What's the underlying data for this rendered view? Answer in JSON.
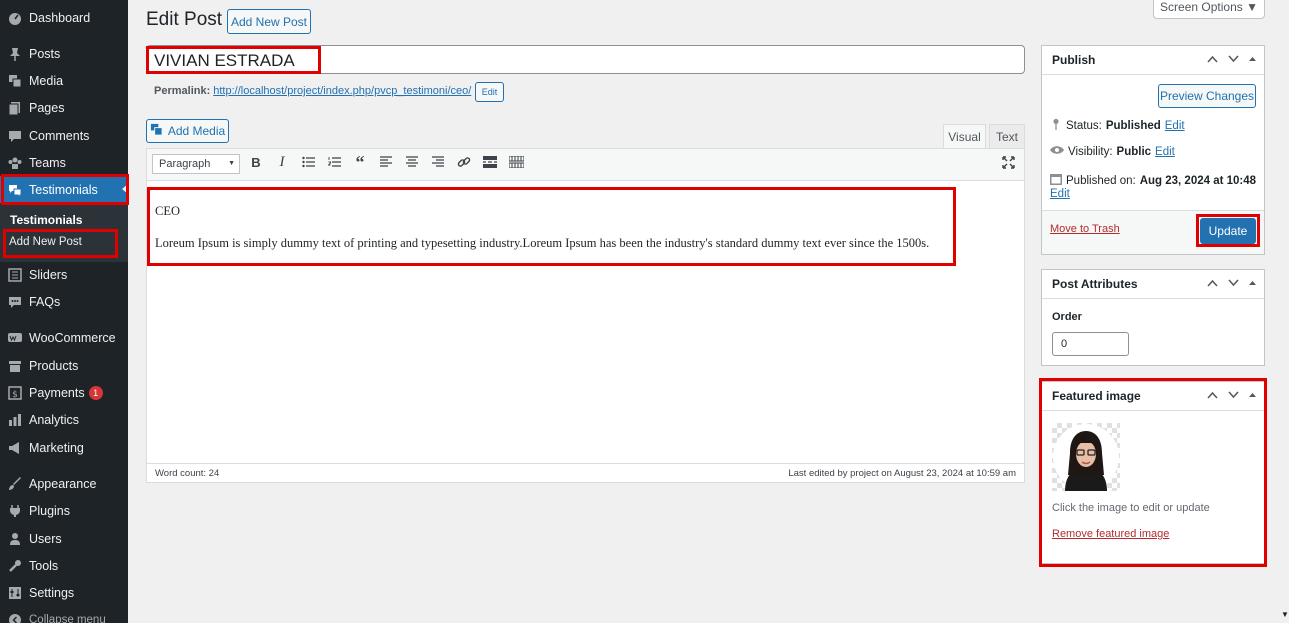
{
  "sidebar": {
    "items": [
      {
        "label": "Dashboard",
        "icon": "dashboard-icon"
      },
      {
        "label": "Posts",
        "icon": "pin-icon"
      },
      {
        "label": "Media",
        "icon": "media-icon"
      },
      {
        "label": "Pages",
        "icon": "pages-icon"
      },
      {
        "label": "Comments",
        "icon": "comments-icon"
      },
      {
        "label": "Teams",
        "icon": "groups-icon"
      },
      {
        "label": "Testimonials",
        "icon": "testimonial-icon"
      },
      {
        "label": "Sliders",
        "icon": "slides-icon"
      },
      {
        "label": "FAQs",
        "icon": "faq-icon"
      },
      {
        "label": "WooCommerce",
        "icon": "woo-icon"
      },
      {
        "label": "Products",
        "icon": "archive-icon"
      },
      {
        "label": "Payments",
        "icon": "money-icon",
        "badge": "1"
      },
      {
        "label": "Analytics",
        "icon": "chart-icon"
      },
      {
        "label": "Marketing",
        "icon": "megaphone-icon"
      },
      {
        "label": "Appearance",
        "icon": "brush-icon"
      },
      {
        "label": "Plugins",
        "icon": "plugin-icon"
      },
      {
        "label": "Users",
        "icon": "user-icon"
      },
      {
        "label": "Tools",
        "icon": "wrench-icon"
      },
      {
        "label": "Settings",
        "icon": "settings-icon"
      },
      {
        "label": "Collapse menu",
        "icon": "collapse-icon"
      }
    ],
    "submenu": {
      "title": "Testimonials",
      "add_new": "Add New Post"
    }
  },
  "header": {
    "title": "Edit Post",
    "add_new": "Add New Post",
    "screen_options": "Screen Options ▼"
  },
  "post": {
    "title": "VIVIAN ESTRADA",
    "permalink_label": "Permalink:",
    "permalink_url": "http://localhost/project/index.php/pvcp_testimoni/ceo/",
    "permalink_edit": "Edit"
  },
  "editor": {
    "add_media": "Add Media",
    "tab_visual": "Visual",
    "tab_text": "Text",
    "format_select": "Paragraph",
    "content_line1": "CEO",
    "content_line2": "Loreum Ipsum is simply dummy text of printing and typesetting industry.Loreum Ipsum has been the industry's standard dummy text ever since the 1500s.",
    "word_count": "Word count: 24",
    "last_edited": "Last edited by project on August 23, 2024 at 10:59 am"
  },
  "publish": {
    "title": "Publish",
    "preview": "Preview Changes",
    "status_label": "Status:",
    "status_value": "Published",
    "visibility_label": "Visibility:",
    "visibility_value": "Public",
    "published_label": "Published on:",
    "published_value": "Aug 23, 2024 at 10:48",
    "edit": "Edit",
    "trash": "Move to Trash",
    "update": "Update"
  },
  "attributes": {
    "title": "Post Attributes",
    "order_label": "Order",
    "order_value": "0"
  },
  "featured": {
    "title": "Featured image",
    "hint": "Click the image to edit or update",
    "remove": "Remove featured image"
  },
  "colors": {
    "accent": "#2271b1",
    "highlight": "#e00000",
    "sidebar": "#1d2327"
  }
}
